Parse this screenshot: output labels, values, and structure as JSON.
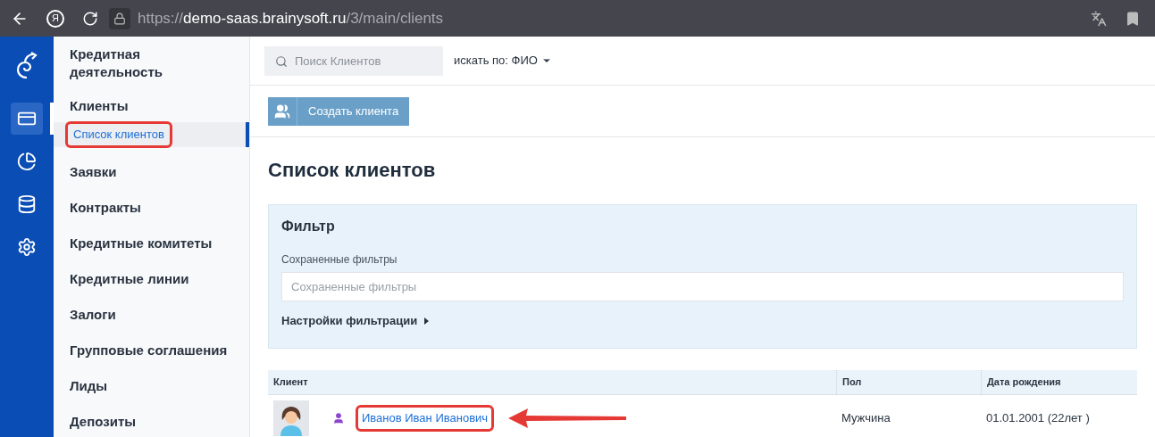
{
  "browser": {
    "url_scheme": "https://",
    "url_host": "demo-saas.brainysoft.ru",
    "url_path": "/3/main/clients",
    "yandex_glyph": "Я"
  },
  "rail": {
    "items": [
      {
        "kind": "card",
        "selected": true
      },
      {
        "kind": "pie",
        "selected": false
      },
      {
        "kind": "database",
        "selected": false
      },
      {
        "kind": "settings",
        "selected": false
      }
    ]
  },
  "sidebar": {
    "title": "Кредитная деятельность",
    "items": [
      {
        "label": "Клиенты",
        "selected": false,
        "children": [
          {
            "label": "Список клиентов",
            "selected": true,
            "highlighted": true
          }
        ]
      },
      {
        "label": "Заявки",
        "selected": false
      },
      {
        "label": "Контракты",
        "selected": false
      },
      {
        "label": "Кредитные комитеты",
        "selected": false
      },
      {
        "label": "Кредитные линии",
        "selected": false
      },
      {
        "label": "Залоги",
        "selected": false
      },
      {
        "label": "Групповые соглашения",
        "selected": false
      },
      {
        "label": "Лиды",
        "selected": false
      },
      {
        "label": "Депозиты",
        "selected": false
      }
    ]
  },
  "search": {
    "placeholder": "Поиск Клиентов",
    "search_by": "искать по: ФИО"
  },
  "create_button": "Создать клиента",
  "page_title": "Список клиентов",
  "filter": {
    "title": "Фильтр",
    "saved_label": "Сохраненные фильтры",
    "saved_placeholder": "Сохраненные фильтры",
    "settings": "Настройки фильтрации",
    "expanded": false
  },
  "table": {
    "columns": [
      "Клиент",
      "Пол",
      "Дата рождения"
    ],
    "rows": [
      {
        "name": "Иванов Иван Иванович",
        "gender": "Мужчина",
        "birth_date": "01.01.2001 (22лет )",
        "highlighted": true
      }
    ]
  }
}
